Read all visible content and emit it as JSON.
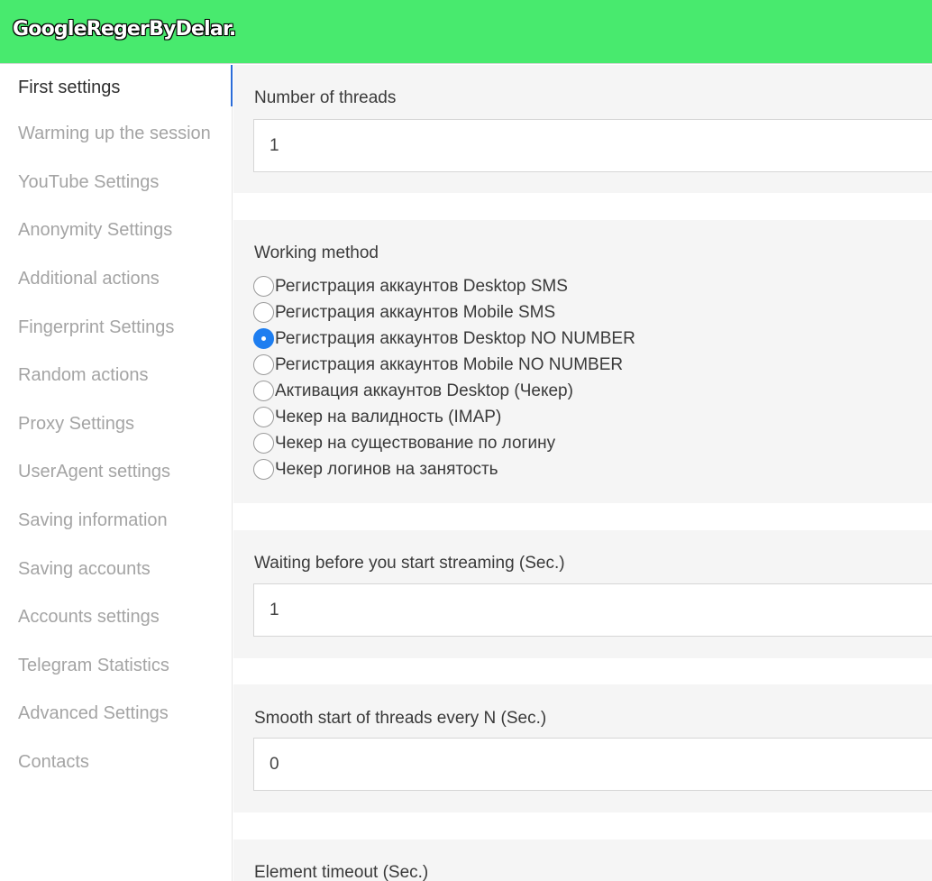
{
  "app": {
    "title": "GoogleRegerByDelar."
  },
  "sidebar": {
    "items": [
      {
        "label": "First settings",
        "active": true
      },
      {
        "label": "Warming up the session"
      },
      {
        "label": "YouTube Settings"
      },
      {
        "label": "Anonymity Settings"
      },
      {
        "label": "Additional actions"
      },
      {
        "label": "Fingerprint Settings"
      },
      {
        "label": "Random actions"
      },
      {
        "label": "Proxy Settings"
      },
      {
        "label": "UserAgent settings"
      },
      {
        "label": "Saving information"
      },
      {
        "label": "Saving accounts"
      },
      {
        "label": "Accounts settings"
      },
      {
        "label": "Telegram Statistics"
      },
      {
        "label": "Advanced Settings"
      },
      {
        "label": "Contacts"
      }
    ]
  },
  "main": {
    "threads": {
      "label": "Number of threads",
      "value": "1"
    },
    "working_method": {
      "label": "Working method",
      "selected_index": 2,
      "options": [
        "Регистрация аккаунтов Desktop SMS",
        "Регистрация аккаунтов Mobile SMS",
        "Регистрация аккаунтов Desktop NO NUMBER",
        "Регистрация аккаунтов Mobile NO NUMBER",
        "Активация аккаунтов Desktop (Чекер)",
        "Чекер на валидность (IMAP)",
        "Чекер на существование по логину",
        "Чекер логинов на занятость"
      ]
    },
    "wait_before_start": {
      "label": "Waiting before you start streaming (Sec.)",
      "value": "1"
    },
    "smooth_start": {
      "label": "Smooth start of threads every N (Sec.)",
      "value": "0"
    },
    "element_timeout": {
      "label": "Element timeout (Sec.)"
    }
  },
  "colors": {
    "header": "#48ea6e",
    "accent": "#1e7ef0",
    "active_indicator": "#2b6cd8"
  }
}
